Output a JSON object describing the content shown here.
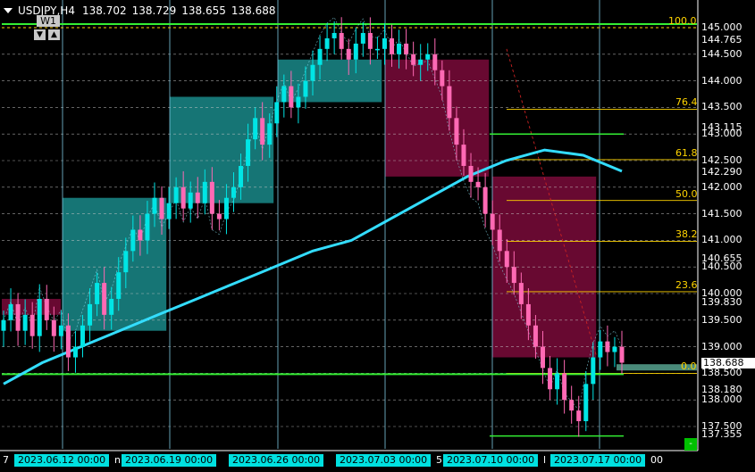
{
  "header": {
    "symbol": "USDJPY,H4",
    "open": "138.702",
    "high": "138.729",
    "low": "138.655",
    "close": "138.688"
  },
  "timeframe_button": {
    "label": "W1",
    "down_arrow": "▼",
    "up_arrow": "▲"
  },
  "colors": {
    "background": "#000000",
    "bull": "#00e5e5",
    "bear": "#ff69b4",
    "ma": "#33ddff",
    "green_line": "#33ee33",
    "fib": "#ffd400",
    "box_teal": "#1a8a8a",
    "box_maroon": "#7a0a3a"
  },
  "price_axis": {
    "labels": [
      "145.000",
      "144.765",
      "144.500",
      "144.000",
      "143.500",
      "143.115",
      "143.000",
      "142.500",
      "142.290",
      "142.000",
      "141.500",
      "141.000",
      "140.655",
      "140.500",
      "140.000",
      "139.830",
      "139.500",
      "139.000",
      "138.688",
      "138.500",
      "138.180",
      "138.000",
      "137.500",
      "137.355"
    ],
    "current": "138.688"
  },
  "time_axis": {
    "left_fragment": "7",
    "dates": [
      "2023.06.12 00:00",
      "2023.06.19 00:00",
      "2023.06.26 00:00",
      "2023.07.03 00:00",
      "2023.07.10 00:00",
      "2023.07.17 00:00"
    ],
    "separators": [
      "n",
      "",
      "",
      "5",
      "l"
    ],
    "right_fragment": "00"
  },
  "fibonacci_levels": [
    "100.0",
    "76.4",
    "61.8",
    "50.0",
    "38.2",
    "23.6",
    "0.0"
  ],
  "corner_button": "-",
  "chart_data": {
    "type": "candlestick",
    "symbol": "USDJPY",
    "timeframe": "H4",
    "ylim": [
      137.25,
      145.15
    ],
    "weekly_markers": [
      "2023.06.12 00:00",
      "2023.06.19 00:00",
      "2023.06.26 00:00",
      "2023.07.03 00:00",
      "2023.07.10 00:00",
      "2023.07.17 00:00"
    ],
    "horizontal_levels": [
      145.0,
      138.5,
      137.355
    ],
    "weekly_boxes": [
      {
        "week": "2023.06.05",
        "open": 139.6,
        "close": 139.9,
        "bull": false
      },
      {
        "week": "2023.06.12",
        "open": 139.3,
        "close": 141.8,
        "bull": true
      },
      {
        "week": "2023.06.19",
        "open": 141.7,
        "close": 143.7,
        "bull": true
      },
      {
        "week": "2023.06.26",
        "open": 143.6,
        "close": 144.4,
        "bull": true
      },
      {
        "week": "2023.07.03",
        "open": 144.4,
        "close": 142.2,
        "bull": false
      },
      {
        "week": "2023.07.10",
        "open": 142.2,
        "close": 138.8,
        "bull": false
      }
    ],
    "moving_average": [
      138.3,
      138.7,
      139.0,
      139.3,
      139.6,
      139.9,
      140.2,
      140.5,
      140.8,
      141.0,
      141.4,
      141.8,
      142.2,
      142.5,
      142.7,
      142.6,
      142.3
    ],
    "fib_retracement": {
      "high": 145.0,
      "low": 138.5,
      "levels": [
        100.0,
        76.4,
        61.8,
        50.0,
        38.2,
        23.6,
        0.0
      ]
    },
    "candles_close": [
      139.5,
      139.8,
      139.3,
      139.6,
      139.2,
      139.9,
      139.5,
      139.2,
      139.4,
      138.8,
      139.0,
      139.4,
      139.8,
      140.2,
      139.6,
      139.9,
      140.4,
      140.8,
      141.2,
      141.0,
      141.5,
      141.8,
      141.4,
      141.7,
      142.0,
      141.6,
      141.9,
      141.7,
      142.1,
      141.5,
      141.4,
      141.8,
      142.0,
      142.4,
      142.9,
      143.3,
      142.8,
      143.2,
      143.6,
      143.9,
      143.5,
      143.7,
      144.0,
      144.3,
      144.6,
      144.8,
      144.9,
      144.6,
      144.4,
      144.7,
      144.9,
      144.6,
      144.6,
      144.8,
      144.5,
      144.7,
      144.5,
      144.3,
      144.4,
      144.5,
      144.2,
      143.9,
      143.3,
      142.8,
      142.4,
      142.1,
      142.0,
      141.5,
      141.2,
      140.8,
      140.5,
      140.2,
      139.8,
      139.4,
      139.0,
      138.6,
      138.2,
      138.5,
      138.0,
      137.8,
      137.6,
      138.3,
      138.8,
      139.1,
      138.9,
      139.0,
      138.7
    ]
  }
}
